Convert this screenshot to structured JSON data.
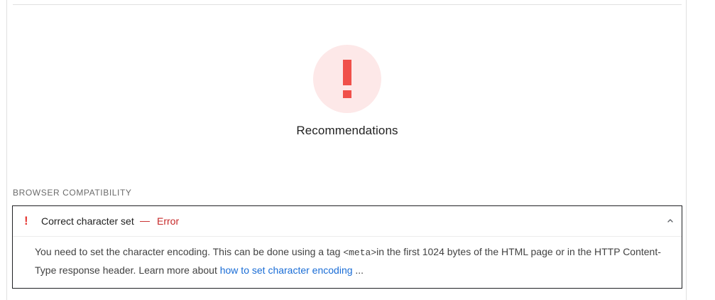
{
  "summary": {
    "title": "Recommendations",
    "status_color": "#f0504a",
    "status_bg": "#fde8e8",
    "icon": "exclamation-icon"
  },
  "section": {
    "heading": "BROWSER COMPATIBILITY"
  },
  "audit": {
    "icon": "error-exclamation-icon",
    "icon_glyph": "!",
    "title": "Correct character set",
    "separator": "—",
    "status": "Error",
    "status_color": "#c62828",
    "expanded": true,
    "description_part1": "You need to set the character encoding. This can be done using a tag ",
    "code": "<meta>",
    "description_part2": "in the first 1024 bytes of the HTML page or in the HTTP Content-Type response header. Learn more about ",
    "link_text": "how to set character encoding",
    "ellipsis": " ..."
  }
}
